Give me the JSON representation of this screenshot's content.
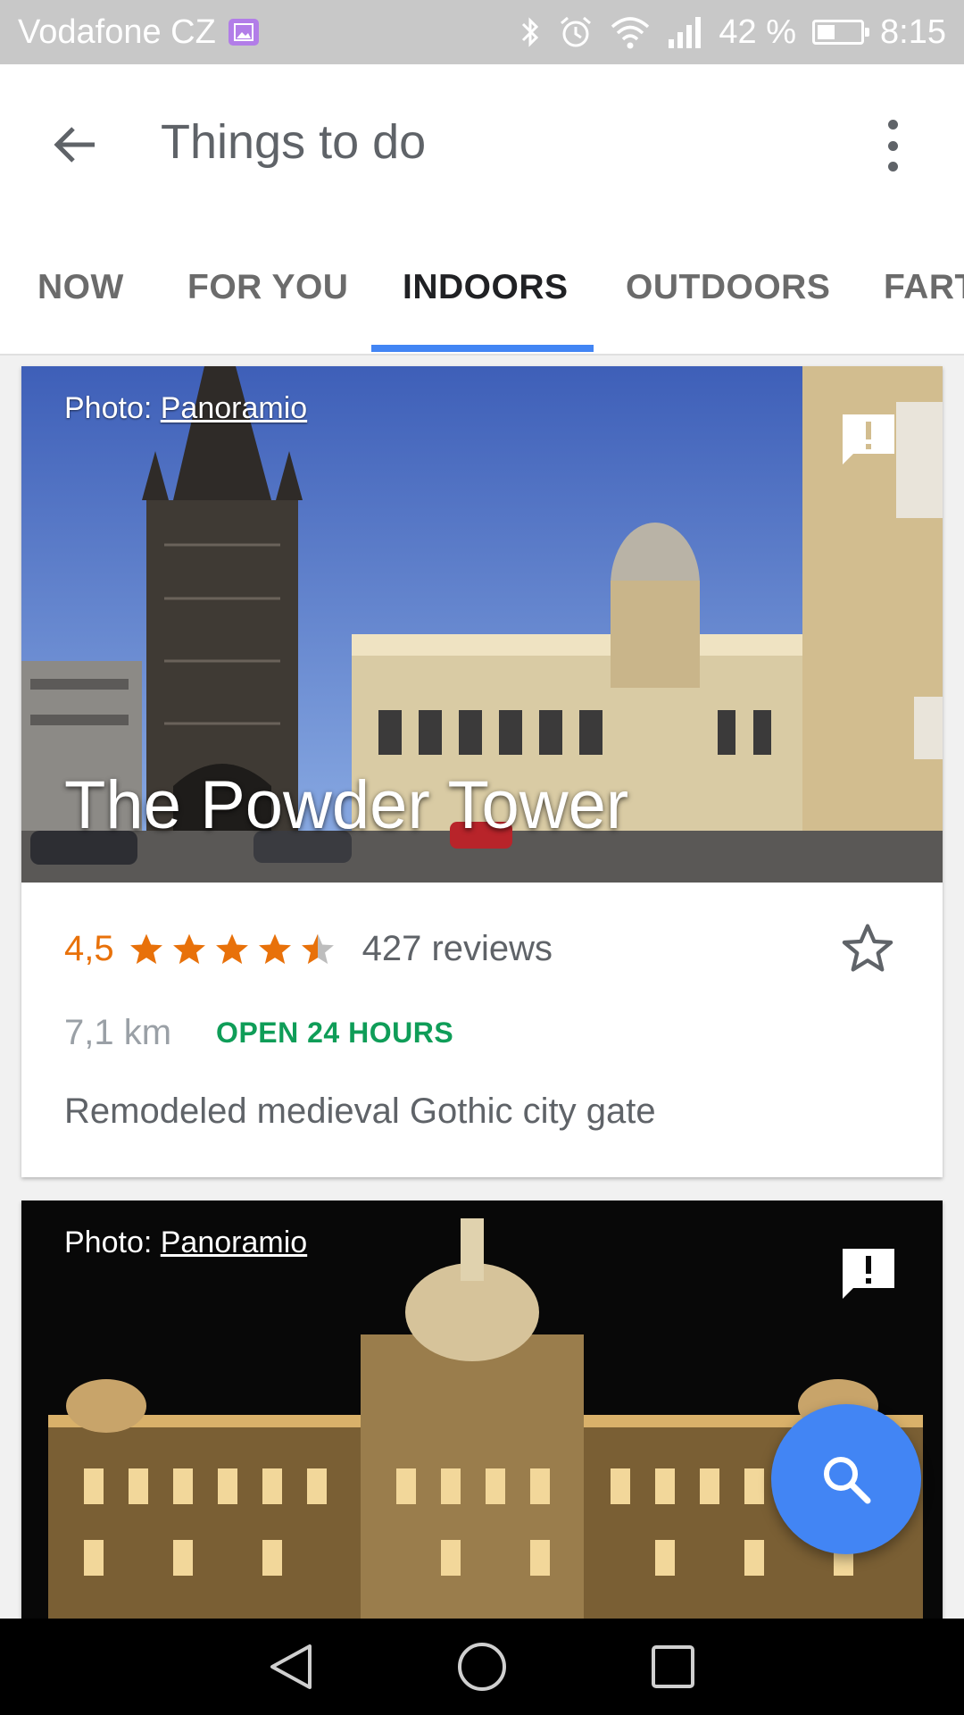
{
  "status_bar": {
    "carrier": "Vodafone CZ",
    "battery": "42 %",
    "battery_level": 0.42,
    "time": "8:15",
    "icons": [
      "gallery-notification-icon",
      "bluetooth-icon",
      "alarm-icon",
      "wifi-icon",
      "signal-icon",
      "battery-icon"
    ]
  },
  "app_bar": {
    "title": "Things to do",
    "back_icon": "arrow-back-icon",
    "menu_icon": "more-vert-icon"
  },
  "tabs": [
    {
      "label": "NOW",
      "active": false
    },
    {
      "label": "FOR YOU",
      "active": false
    },
    {
      "label": "INDOORS",
      "active": true
    },
    {
      "label": "OUTDOORS",
      "active": false
    },
    {
      "label": "FART",
      "active": false
    }
  ],
  "cards": [
    {
      "photo_credit_prefix": "Photo: ",
      "photo_credit_link": "Panoramio",
      "name": "The Powder Tower",
      "rating": "4,5",
      "stars": 4.5,
      "reviews": "427 reviews",
      "distance": "7,1 km",
      "hours": "OPEN 24 HOURS",
      "description": "Remodeled medieval Gothic city gate"
    },
    {
      "photo_credit_prefix": "Photo: ",
      "photo_credit_link": "Panoramio"
    }
  ],
  "fab": {
    "icon": "search-icon"
  },
  "nav_bar": {
    "icons": [
      "nav-back-icon",
      "nav-home-icon",
      "nav-recents-icon"
    ]
  },
  "colors": {
    "accent": "#4285f4",
    "rating": "#e8710a",
    "open": "#0f9d58",
    "status_bar": "#c8c8c8"
  }
}
